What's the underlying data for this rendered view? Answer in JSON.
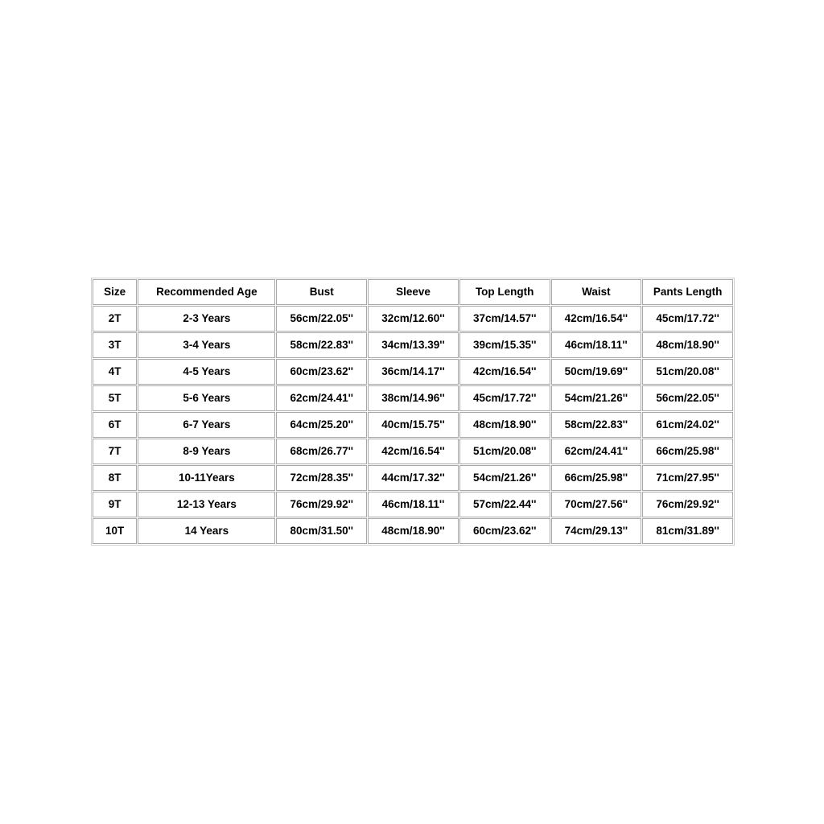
{
  "chart_data": {
    "type": "table",
    "title": "",
    "columns": [
      "Size",
      "Recommended Age",
      "Bust",
      "Sleeve",
      "Top Length",
      "Waist",
      "Pants Length"
    ],
    "rows": [
      [
        "2T",
        "2-3 Years",
        "56cm/22.05''",
        "32cm/12.60''",
        "37cm/14.57''",
        "42cm/16.54''",
        "45cm/17.72''"
      ],
      [
        "3T",
        "3-4 Years",
        "58cm/22.83''",
        "34cm/13.39''",
        "39cm/15.35''",
        "46cm/18.11''",
        "48cm/18.90''"
      ],
      [
        "4T",
        "4-5 Years",
        "60cm/23.62''",
        "36cm/14.17''",
        "42cm/16.54''",
        "50cm/19.69''",
        "51cm/20.08''"
      ],
      [
        "5T",
        "5-6 Years",
        "62cm/24.41''",
        "38cm/14.96''",
        "45cm/17.72''",
        "54cm/21.26''",
        "56cm/22.05''"
      ],
      [
        "6T",
        "6-7 Years",
        "64cm/25.20''",
        "40cm/15.75''",
        "48cm/18.90''",
        "58cm/22.83''",
        "61cm/24.02''"
      ],
      [
        "7T",
        "8-9 Years",
        "68cm/26.77''",
        "42cm/16.54''",
        "51cm/20.08''",
        "62cm/24.41''",
        "66cm/25.98''"
      ],
      [
        "8T",
        "10-11Years",
        "72cm/28.35''",
        "44cm/17.32''",
        "54cm/21.26''",
        "66cm/25.98''",
        "71cm/27.95''"
      ],
      [
        "9T",
        "12-13 Years",
        "76cm/29.92''",
        "46cm/18.11''",
        "57cm/22.44''",
        "70cm/27.56''",
        "76cm/29.92''"
      ],
      [
        "10T",
        "14 Years",
        "80cm/31.50''",
        "48cm/18.90''",
        "60cm/23.62''",
        "74cm/29.13''",
        "81cm/31.89''"
      ]
    ]
  },
  "colors": {
    "page_background": "#ffffff",
    "cell_background": "#ffffff",
    "cell_border": "#a8a8a8",
    "table_border": "#d0d0d0",
    "text": "#000000"
  }
}
